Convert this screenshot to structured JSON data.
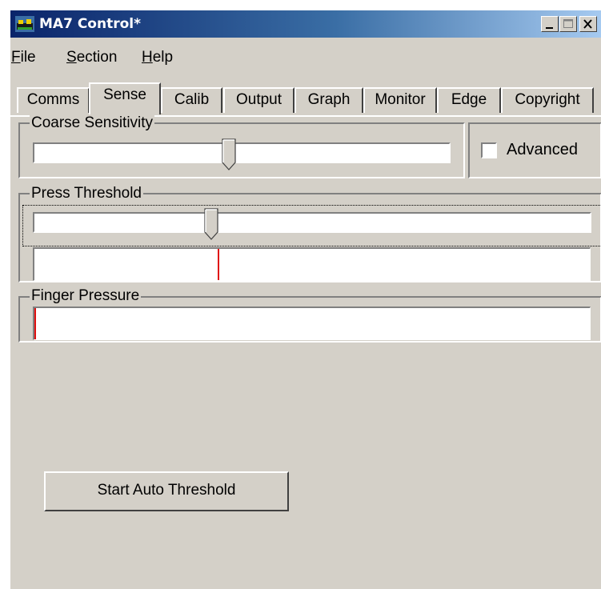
{
  "window": {
    "title": "MA7 Control*"
  },
  "menu": {
    "items": [
      {
        "label": "File",
        "key": "F",
        "rest": "ile"
      },
      {
        "label": "Section",
        "key": "S",
        "rest": "ection"
      },
      {
        "label": "Help",
        "key": "H",
        "rest": "elp"
      }
    ]
  },
  "tabs": {
    "items": [
      "Comms",
      "Sense",
      "Calib",
      "Output",
      "Graph",
      "Monitor",
      "Edge",
      "Copyright"
    ],
    "active": "Sense"
  },
  "coarse_sensitivity": {
    "label": "Coarse Sensitivity",
    "value_fraction": 0.47
  },
  "advanced": {
    "label": "Advanced",
    "checked": false
  },
  "press_threshold": {
    "label": "Press Threshold",
    "value_fraction": 0.32,
    "marker_fraction": 0.33
  },
  "finger_pressure": {
    "label": "Finger Pressure",
    "marker_fraction": 0.0
  },
  "actions": {
    "start_auto_threshold": "Start Auto Threshold"
  },
  "colors": {
    "titlebar_start": "#0a246a",
    "titlebar_end": "#a6caf0",
    "face": "#d4d0c8",
    "marker": "#e01010"
  }
}
